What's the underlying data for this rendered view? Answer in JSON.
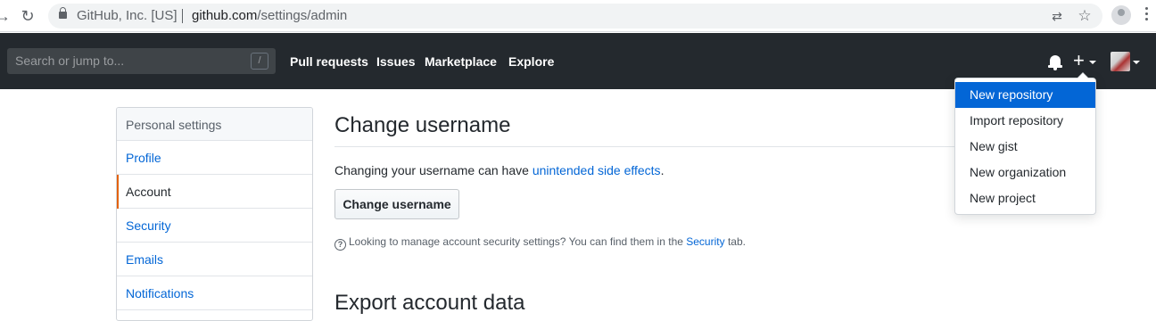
{
  "browser": {
    "org_label": "GitHub, Inc. [US]",
    "url_host": "github.com",
    "url_path": "/settings/admin"
  },
  "header": {
    "search_placeholder": "Search or jump to...",
    "search_shortcut": "/",
    "nav": [
      "Pull requests",
      "Issues",
      "Marketplace",
      "Explore"
    ],
    "create_symbol": "+"
  },
  "create_menu": {
    "items": [
      "New repository",
      "Import repository",
      "New gist",
      "New organization",
      "New project"
    ],
    "highlighted_index": 0,
    "highlight_color": "#0366d6"
  },
  "sidebar": {
    "heading": "Personal settings",
    "items": [
      "Profile",
      "Account",
      "Security",
      "Emails",
      "Notifications"
    ],
    "active_index": 1,
    "active_accent": "#e36209"
  },
  "main": {
    "change_username": {
      "title": "Change username",
      "text_before": "Changing your username can have ",
      "link": "unintended side effects",
      "text_after": ".",
      "button": "Change username",
      "note_before": "Looking to manage account security settings? You can find them in the ",
      "note_link": "Security",
      "note_after": " tab."
    },
    "export_title": "Export account data"
  },
  "colors": {
    "header_bg": "#24292e",
    "link": "#0366d6"
  }
}
